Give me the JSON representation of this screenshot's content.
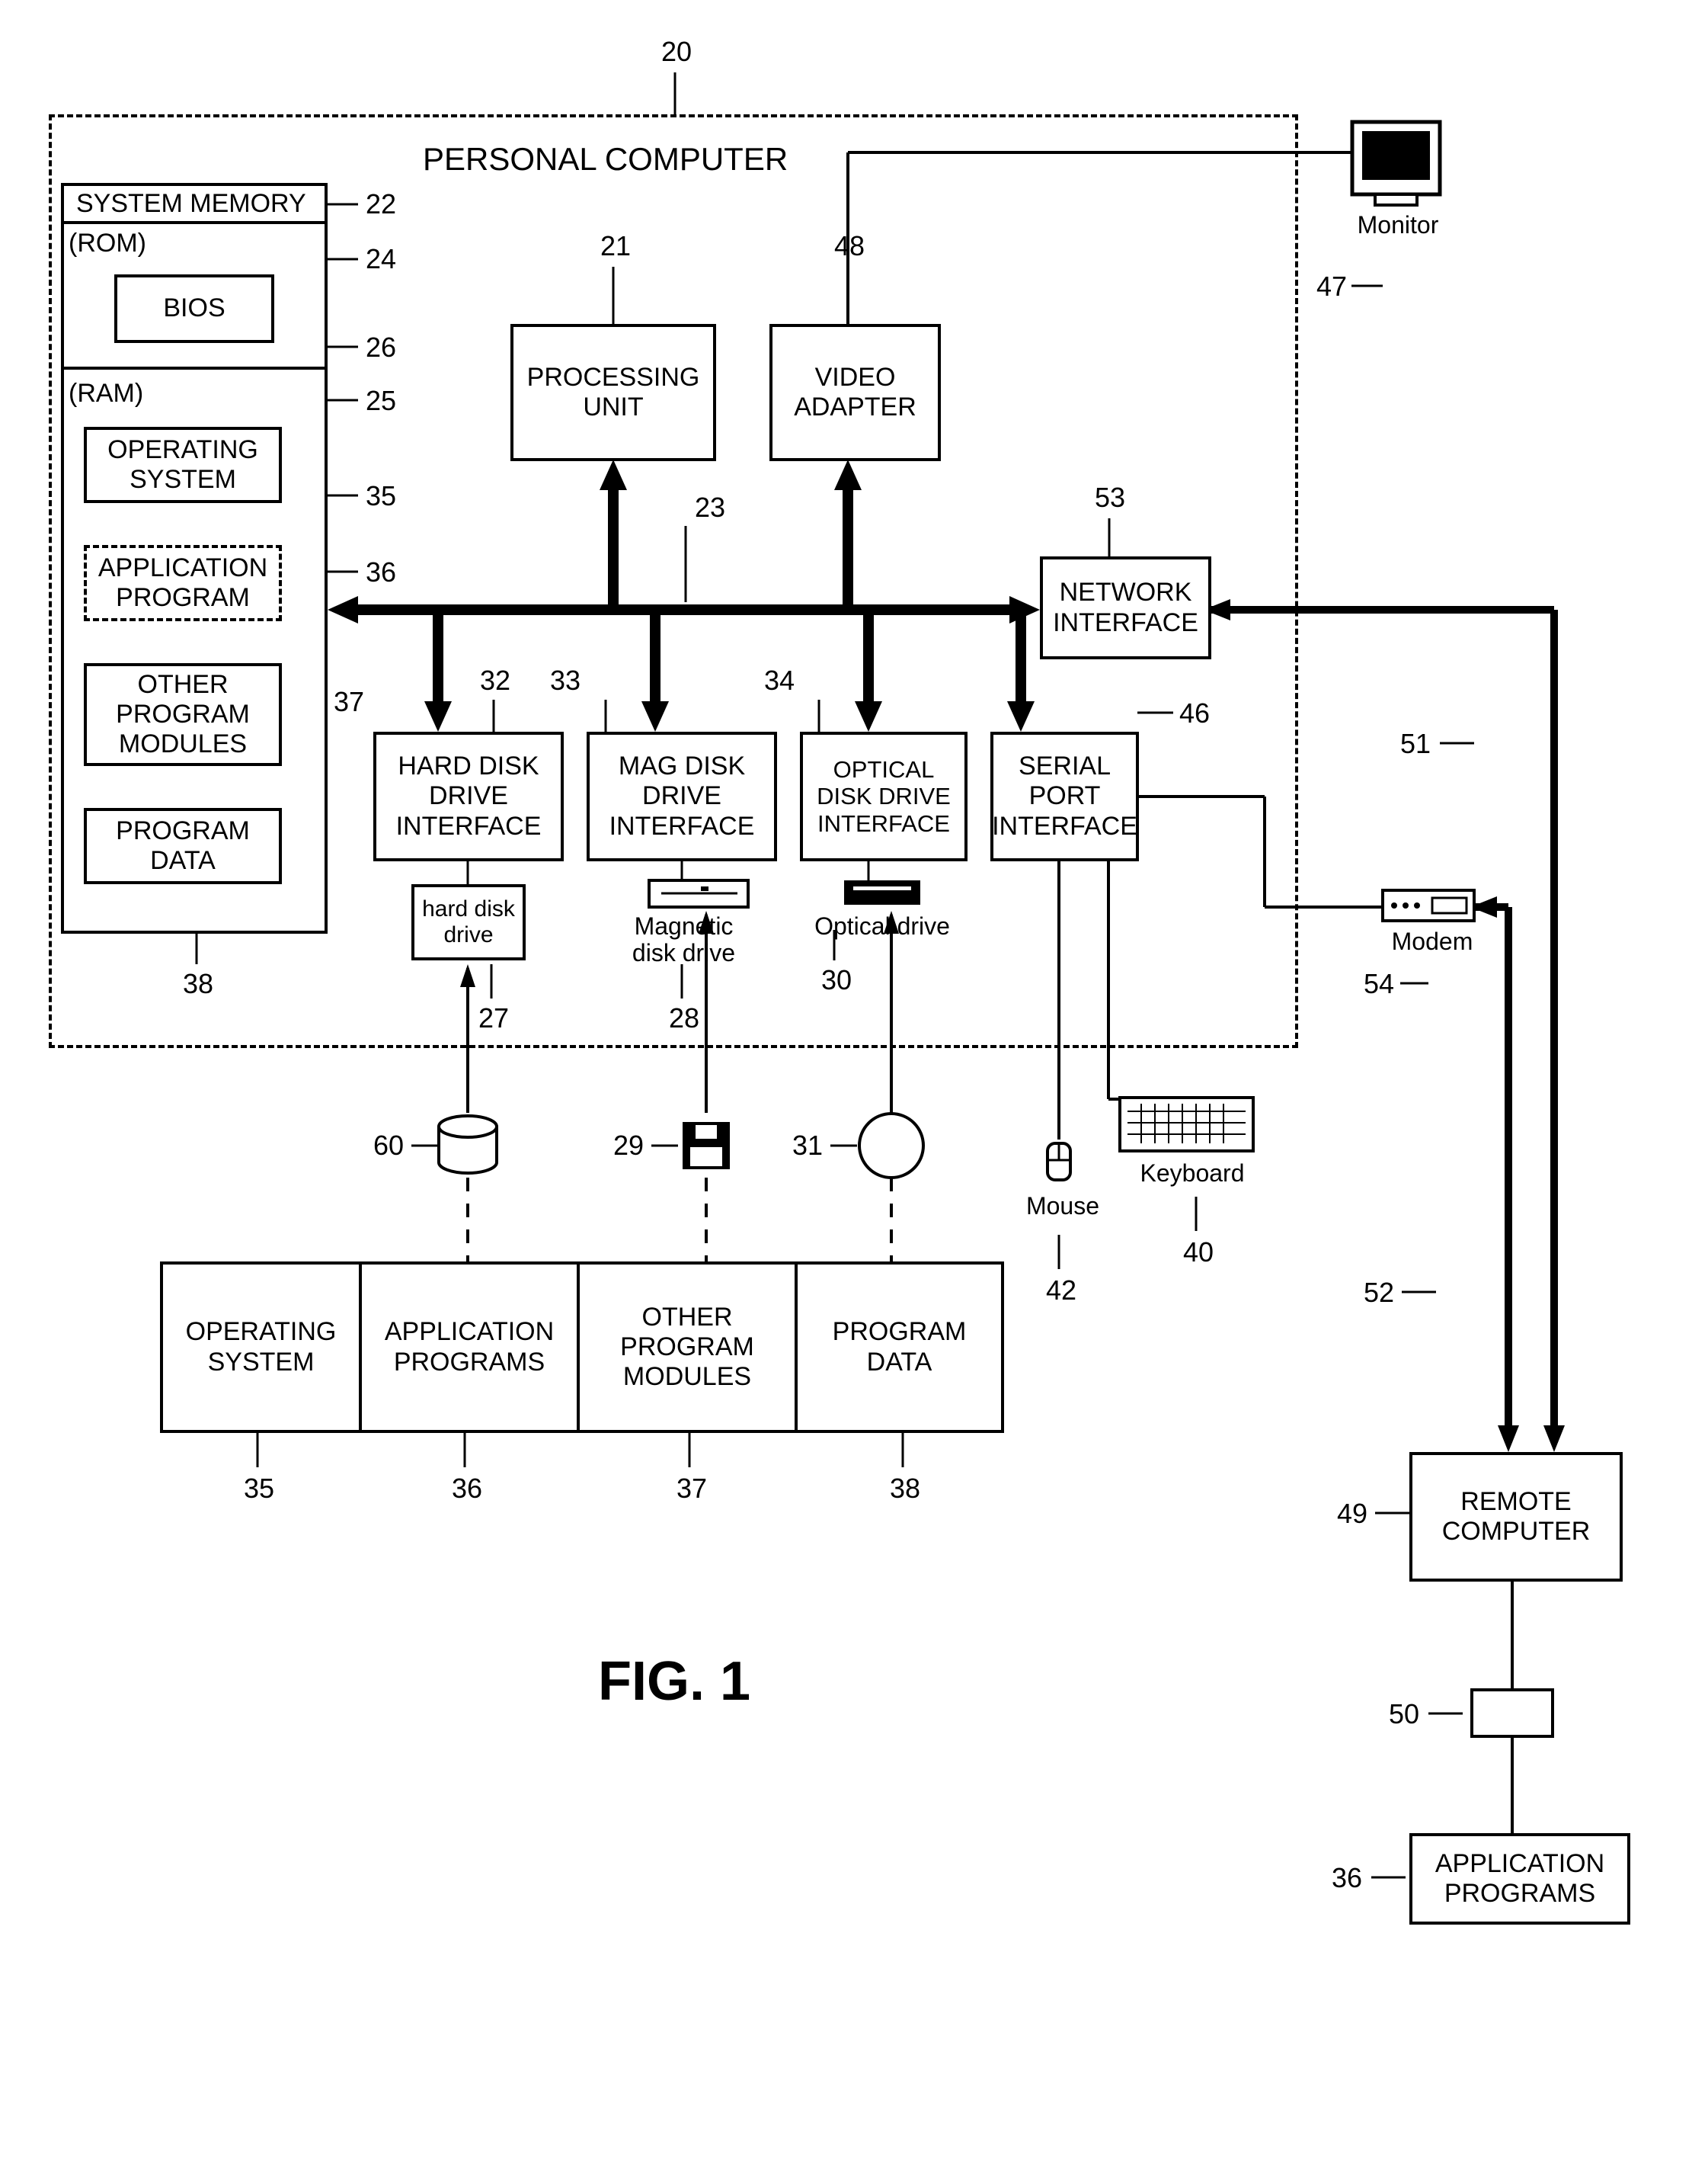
{
  "title": "PERSONAL COMPUTER",
  "figure": "FIG. 1",
  "refs": {
    "r20": "20",
    "r21": "21",
    "r22": "22",
    "r23": "23",
    "r24": "24",
    "r25": "25",
    "r26": "26",
    "r27": "27",
    "r28": "28",
    "r29": "29",
    "r30": "30",
    "r31": "31",
    "r32": "32",
    "r33": "33",
    "r34": "34",
    "r35": "35",
    "r36": "36",
    "r37": "37",
    "r38": "38",
    "r40": "40",
    "r42": "42",
    "r46": "46",
    "r47": "47",
    "r48": "48",
    "r49": "49",
    "r50": "50",
    "r51": "51",
    "r52": "52",
    "r53": "53",
    "r54": "54",
    "r60": "60"
  },
  "blocks": {
    "system_memory": "SYSTEM MEMORY",
    "rom": "(ROM)",
    "bios": "BIOS",
    "ram": "(RAM)",
    "operating_system": "OPERATING SYSTEM",
    "application_program": "APPLICATION PROGRAM",
    "other_program_modules": "OTHER PROGRAM MODULES",
    "program_data": "PROGRAM DATA",
    "processing_unit": "PROCESSING UNIT",
    "video_adapter": "VIDEO ADAPTER",
    "network_interface": "NETWORK INTERFACE",
    "hard_disk_drive_interface": "HARD DISK DRIVE INTERFACE",
    "mag_disk_drive_interface": "MAG DISK DRIVE INTERFACE",
    "optical_disk_drive_interface": "OPTICAL DISK DRIVE INTERFACE",
    "serial_port_interface": "SERIAL PORT INTERFACE",
    "hard_disk_drive": "hard disk drive",
    "magnetic_disk_drive": "Magnetic disk drive",
    "optical_drive": "Optical drive",
    "bottom_os": "OPERATING SYSTEM",
    "bottom_apps": "APPLICATION PROGRAMS",
    "bottom_other": "OTHER PROGRAM MODULES",
    "bottom_pdata": "PROGRAM DATA",
    "monitor": "Monitor",
    "mouse": "Mouse",
    "keyboard": "Keyboard",
    "modem": "Modem",
    "remote_computer": "REMOTE COMPUTER",
    "application_programs": "APPLICATION PROGRAMS"
  }
}
